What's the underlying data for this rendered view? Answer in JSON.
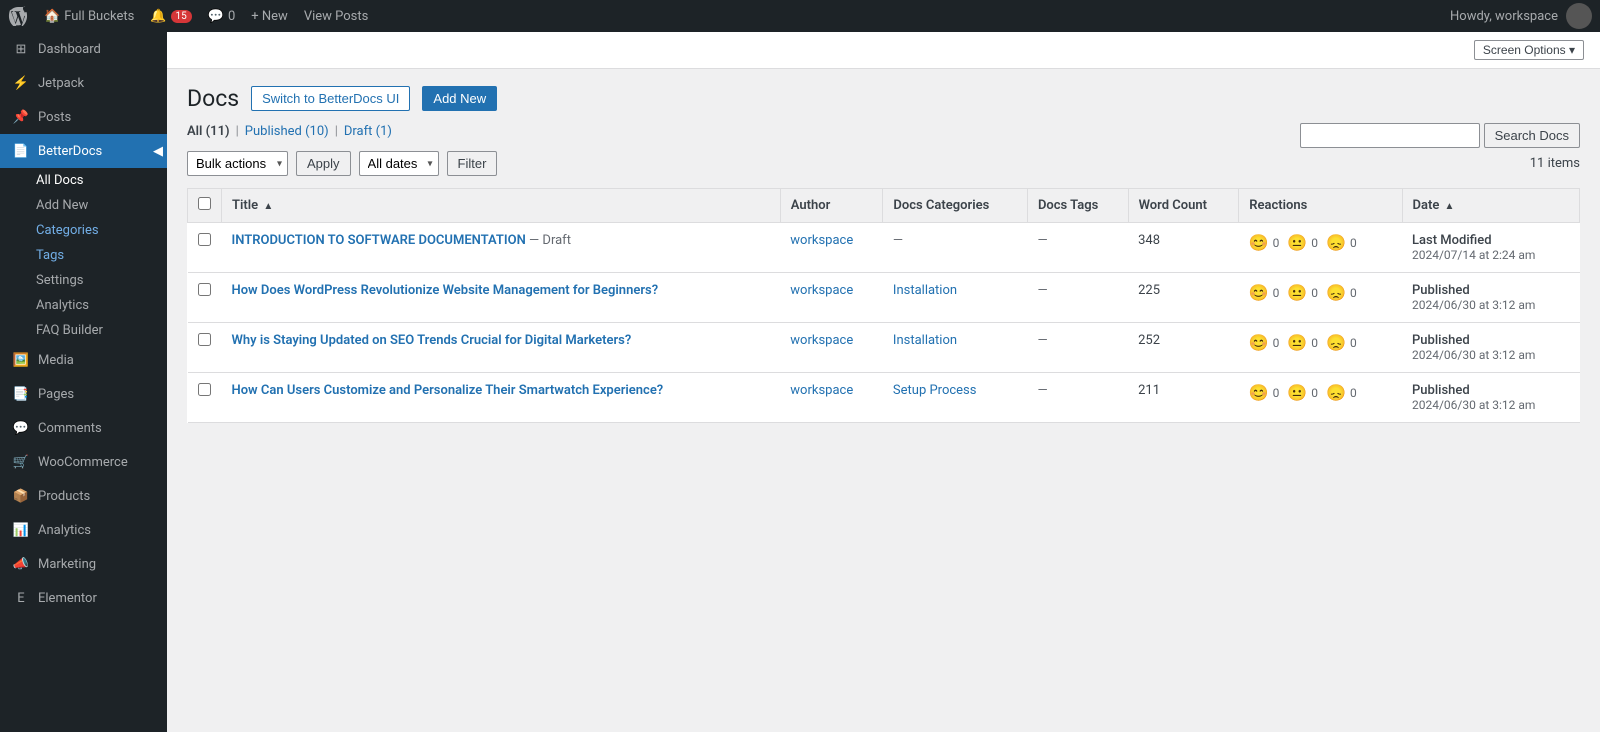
{
  "topbar": {
    "site_name": "Full Buckets",
    "notifications_count": "15",
    "comments_count": "0",
    "new_label": "+ New",
    "view_posts_label": "View Posts",
    "howdy_label": "Howdy, workspace"
  },
  "screen_options": {
    "label": "Screen Options ▾"
  },
  "sidebar": {
    "items": [
      {
        "id": "dashboard",
        "label": "Dashboard",
        "icon": "dashboard"
      },
      {
        "id": "jetpack",
        "label": "Jetpack",
        "icon": "jetpack"
      },
      {
        "id": "posts",
        "label": "Posts",
        "icon": "posts"
      },
      {
        "id": "betterdocs",
        "label": "BetterDocs",
        "icon": "betterdocs",
        "active": true
      },
      {
        "id": "media",
        "label": "Media",
        "icon": "media"
      },
      {
        "id": "pages",
        "label": "Pages",
        "icon": "pages"
      },
      {
        "id": "comments",
        "label": "Comments",
        "icon": "comments"
      },
      {
        "id": "woocommerce",
        "label": "WooCommerce",
        "icon": "woocommerce"
      },
      {
        "id": "products",
        "label": "Products",
        "icon": "products"
      },
      {
        "id": "analytics",
        "label": "Analytics",
        "icon": "analytics"
      },
      {
        "id": "marketing",
        "label": "Marketing",
        "icon": "marketing"
      },
      {
        "id": "elementor",
        "label": "Elementor",
        "icon": "elementor"
      }
    ],
    "betterdocs_sub": [
      {
        "id": "all-docs",
        "label": "All Docs",
        "active": true
      },
      {
        "id": "add-new",
        "label": "Add New"
      },
      {
        "id": "categories",
        "label": "Categories",
        "active_blue": true
      },
      {
        "id": "tags",
        "label": "Tags",
        "active_blue": true
      },
      {
        "id": "settings",
        "label": "Settings"
      },
      {
        "id": "analytics-sub",
        "label": "Analytics"
      },
      {
        "id": "faq-builder",
        "label": "FAQ Builder"
      }
    ]
  },
  "page": {
    "title": "Docs",
    "switch_btn": "Switch to BetterDocs UI",
    "add_new_btn": "Add New"
  },
  "filter_links": [
    {
      "id": "all",
      "label": "All",
      "count": "11",
      "current": true
    },
    {
      "id": "published",
      "label": "Published",
      "count": "10"
    },
    {
      "id": "draft",
      "label": "Draft",
      "count": "1"
    }
  ],
  "search": {
    "placeholder": "",
    "button_label": "Search Docs"
  },
  "toolbar": {
    "bulk_actions_label": "Bulk actions",
    "apply_label": "Apply",
    "all_dates_label": "All dates",
    "filter_label": "Filter",
    "item_count": "11 items"
  },
  "table": {
    "columns": [
      {
        "id": "title",
        "label": "Title",
        "sort": "▲"
      },
      {
        "id": "author",
        "label": "Author"
      },
      {
        "id": "docs_categories",
        "label": "Docs Categories"
      },
      {
        "id": "docs_tags",
        "label": "Docs Tags"
      },
      {
        "id": "word_count",
        "label": "Word Count"
      },
      {
        "id": "reactions",
        "label": "Reactions"
      },
      {
        "id": "date",
        "label": "Date",
        "sort": "▲"
      }
    ],
    "rows": [
      {
        "id": 1,
        "title": "INTRODUCTION TO SOFTWARE DOCUMENTATION",
        "title_suffix": "— Draft",
        "author": "workspace",
        "category": "—",
        "tags": "—",
        "word_count": "348",
        "reactions": {
          "happy": "0",
          "neutral": "0",
          "sad": "0"
        },
        "date_status": "Last Modified",
        "date_value": "2024/07/14 at 2:24 am"
      },
      {
        "id": 2,
        "title": "How Does WordPress Revolutionize Website Management for Beginners?",
        "title_suffix": "",
        "author": "workspace",
        "category": "Installation",
        "tags": "—",
        "word_count": "225",
        "reactions": {
          "happy": "0",
          "neutral": "0",
          "sad": "0"
        },
        "date_status": "Published",
        "date_value": "2024/06/30 at 3:12 am"
      },
      {
        "id": 3,
        "title": "Why is Staying Updated on SEO Trends Crucial for Digital Marketers?",
        "title_suffix": "",
        "author": "workspace",
        "category": "Installation",
        "tags": "—",
        "word_count": "252",
        "reactions": {
          "happy": "0",
          "neutral": "0",
          "sad": "0"
        },
        "date_status": "Published",
        "date_value": "2024/06/30 at 3:12 am"
      },
      {
        "id": 4,
        "title": "How Can Users Customize and Personalize Their Smartwatch Experience?",
        "title_suffix": "",
        "author": "workspace",
        "category": "Setup Process",
        "tags": "—",
        "word_count": "211",
        "reactions": {
          "happy": "0",
          "neutral": "0",
          "sad": "0"
        },
        "date_status": "Published",
        "date_value": "2024/06/30 at 3:12 am"
      }
    ]
  }
}
